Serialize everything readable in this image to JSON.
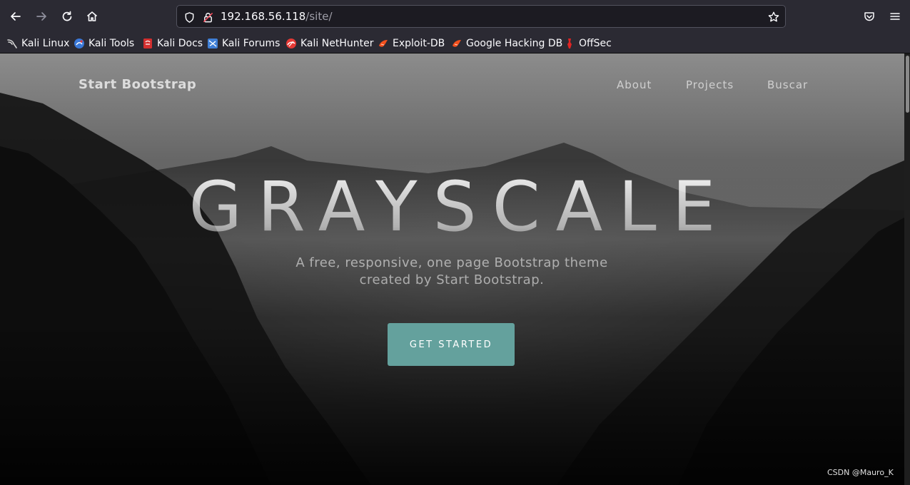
{
  "browser": {
    "url_host": "192.168.56.118",
    "url_path": "/site/",
    "bookmarks": [
      {
        "label": "Kali Linux",
        "icon": "kali-dragon-icon"
      },
      {
        "label": "Kali Tools",
        "icon": "kali-tools-icon"
      },
      {
        "label": "Kali Docs",
        "icon": "kali-docs-icon"
      },
      {
        "label": "Kali Forums",
        "icon": "kali-forums-icon"
      },
      {
        "label": "Kali NetHunter",
        "icon": "kali-nethunter-icon"
      },
      {
        "label": "Exploit-DB",
        "icon": "exploit-db-icon"
      },
      {
        "label": "Google Hacking DB",
        "icon": "ghdb-icon"
      },
      {
        "label": "OffSec",
        "icon": "offsec-icon"
      }
    ],
    "colors": {
      "chrome": "#2b2a33",
      "urlbar": "#1c1b22",
      "text": "#fbfbfe"
    }
  },
  "page": {
    "brand": "Start Bootstrap",
    "nav": [
      "About",
      "Projects",
      "Buscar"
    ],
    "hero_title": "GRAYSCALE",
    "hero_subtitle": "A free, responsive, one page Bootstrap theme created by Start Bootstrap.",
    "cta_label": "GET STARTED",
    "accent_color": "#64a19d"
  },
  "watermark": "CSDN @Mauro_K"
}
